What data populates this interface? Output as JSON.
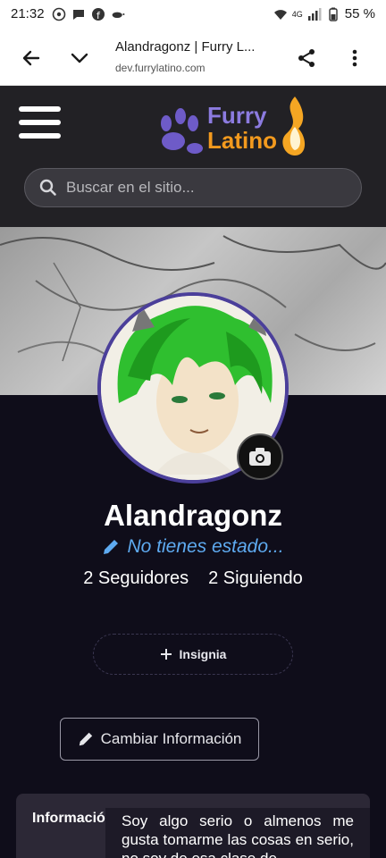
{
  "status_bar": {
    "time": "21:32",
    "battery": "55 %",
    "network": "4G"
  },
  "browser": {
    "page_title": "Alandragonz | Furry L...",
    "url": "dev.furrylatino.com"
  },
  "header": {
    "logo_line1": "Furry",
    "logo_line2": "Latino",
    "search_placeholder": "Buscar en el sitio..."
  },
  "profile": {
    "username": "Alandragonz",
    "status": "No tienes estado...",
    "followers": "2 Seguidores",
    "following": "2 Siguiendo",
    "badge_label": "Insignia",
    "edit_label": "Cambiar Información"
  },
  "info": {
    "label": "Información",
    "bio": "Soy algo serio o almenos me gusta tomarme las cosas en serio, no soy de esa clase de"
  },
  "colors": {
    "accent": "#5eaaf0",
    "page_bg": "#0f0d1a",
    "header_bg": "#222125",
    "avatar_border": "#4b3f9a"
  }
}
